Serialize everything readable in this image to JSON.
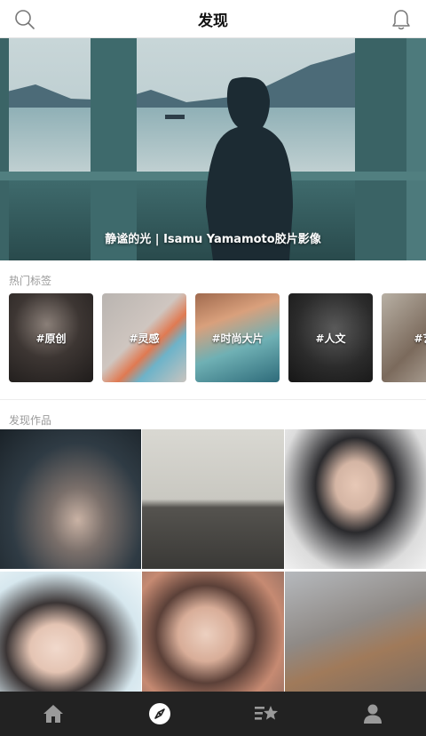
{
  "header": {
    "title": "发现",
    "search_icon": "search-icon",
    "bell_icon": "bell-icon"
  },
  "banner": {
    "caption": "静谧的光 | Isamu Yamamoto胶片影像"
  },
  "hot_tags": {
    "title": "热门标签",
    "items": [
      {
        "label": "#原创"
      },
      {
        "label": "#灵感"
      },
      {
        "label": "#时尚大片"
      },
      {
        "label": "#人文"
      },
      {
        "label": "#艺"
      }
    ]
  },
  "works": {
    "title": "发现作品",
    "count_visible": 6
  },
  "tabbar": {
    "items": [
      {
        "icon": "home-icon",
        "active": false
      },
      {
        "icon": "compass-icon",
        "active": true
      },
      {
        "icon": "ranking-star-icon",
        "active": false
      },
      {
        "icon": "profile-icon",
        "active": false
      }
    ],
    "active_color": "#ffffff",
    "inactive_color": "#9a9a9a"
  }
}
